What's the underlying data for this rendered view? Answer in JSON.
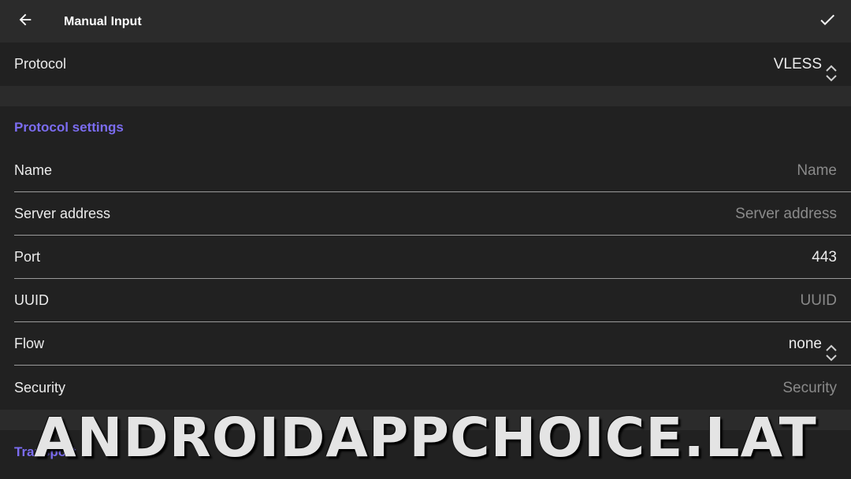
{
  "header": {
    "title": "Manual Input",
    "back_icon": "arrow-left-icon",
    "confirm_icon": "check-icon"
  },
  "protocol": {
    "label": "Protocol",
    "value": "VLESS"
  },
  "protocol_settings": {
    "header": "Protocol settings",
    "fields": [
      {
        "label": "Name",
        "value": "",
        "placeholder": "Name"
      },
      {
        "label": "Server address",
        "value": "",
        "placeholder": "Server address"
      },
      {
        "label": "Port",
        "value": "443",
        "placeholder": ""
      },
      {
        "label": "UUID",
        "value": "",
        "placeholder": "UUID"
      },
      {
        "label": "Flow",
        "value": "none",
        "placeholder": ""
      },
      {
        "label": "Security",
        "value": "",
        "placeholder": "Security"
      }
    ]
  },
  "transport": {
    "header": "Transport"
  },
  "watermark": "ANDROIDAPPCHOICE.LAT",
  "colors": {
    "background": "#212121",
    "bar": "#2b2b2b",
    "accent": "#7b6cf0",
    "text": "#ececec",
    "placeholder": "#8a8a8a"
  }
}
